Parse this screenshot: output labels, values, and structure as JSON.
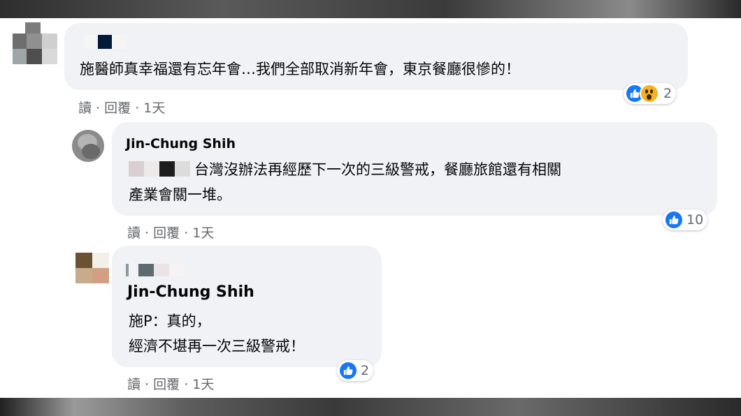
{
  "comments": [
    {
      "text_lines": [
        "施醫師真幸福還有忘年會…我們全部取消新年會，東京餐廳很慘的！"
      ],
      "reactions": {
        "count": "2",
        "types": [
          "like-icon",
          "wow-icon"
        ]
      },
      "actions": {
        "read": "讀",
        "reply": "回覆",
        "time": "1天",
        "sep": " · "
      }
    },
    {
      "author": "Jin-Chung Shih",
      "text_lines": [
        "台灣沒辦法再經歷下一次的三級警戒，餐廳旅館還有相關",
        "產業會關一堆。"
      ],
      "reactions": {
        "count": "10",
        "types": [
          "like-icon"
        ]
      },
      "actions": {
        "read": "讀",
        "reply": "回覆",
        "time": "1天",
        "sep": " · "
      }
    },
    {
      "author": "Jin-Chung Shih",
      "text_lines": [
        "施P：真的，",
        "經濟不堪再一次三級警戒！"
      ],
      "reactions": {
        "count": "2",
        "types": [
          "like-icon"
        ]
      },
      "actions": {
        "read": "讀",
        "reply": "回覆",
        "time": "1天",
        "sep": " · "
      }
    }
  ],
  "colors": {
    "bubble": "#f0f2f5",
    "like": "#1877f2",
    "wow": "#f7b125",
    "meta": "#65676b"
  }
}
